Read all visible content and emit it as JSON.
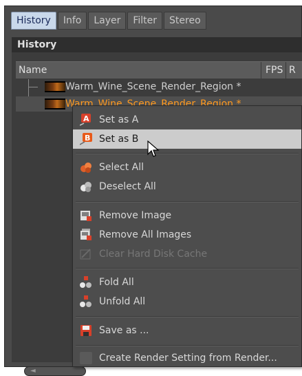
{
  "tabs": [
    "History",
    "Info",
    "Layer",
    "Filter",
    "Stereo"
  ],
  "panel_title": "History",
  "columns": {
    "name": "Name",
    "fps": "FPS",
    "r": "R"
  },
  "rows": [
    {
      "label": "Warm_Wine_Scene_Render_Region *",
      "color": "#d0d0d0"
    },
    {
      "label": "Warm_Wine_Scene_Render_Region *",
      "color": "#ff9a20"
    }
  ],
  "menu": {
    "items": [
      {
        "label": "Set as A",
        "icon": "set-a-icon"
      },
      {
        "label": "Set as B",
        "icon": "set-b-icon",
        "hover": true
      },
      {
        "label": "Select All",
        "icon": "select-all-icon"
      },
      {
        "label": "Deselect All",
        "icon": "deselect-all-icon"
      },
      {
        "label": "Remove Image",
        "icon": "remove-image-icon"
      },
      {
        "label": "Remove All Images",
        "icon": "remove-all-images-icon"
      },
      {
        "label": "Clear Hard Disk Cache",
        "icon": "clear-cache-icon",
        "disabled": true
      },
      {
        "label": "Fold All",
        "icon": "fold-all-icon"
      },
      {
        "label": "Unfold All",
        "icon": "unfold-all-icon"
      },
      {
        "label": "Save as ...",
        "icon": "save-icon"
      },
      {
        "label": "Create Render Setting from Render...",
        "icon": "blank-icon"
      }
    ]
  },
  "colors": {
    "accent_orange": "#ff9a20",
    "active_tab": "#c9d8ea",
    "hover": "#cccccc"
  }
}
